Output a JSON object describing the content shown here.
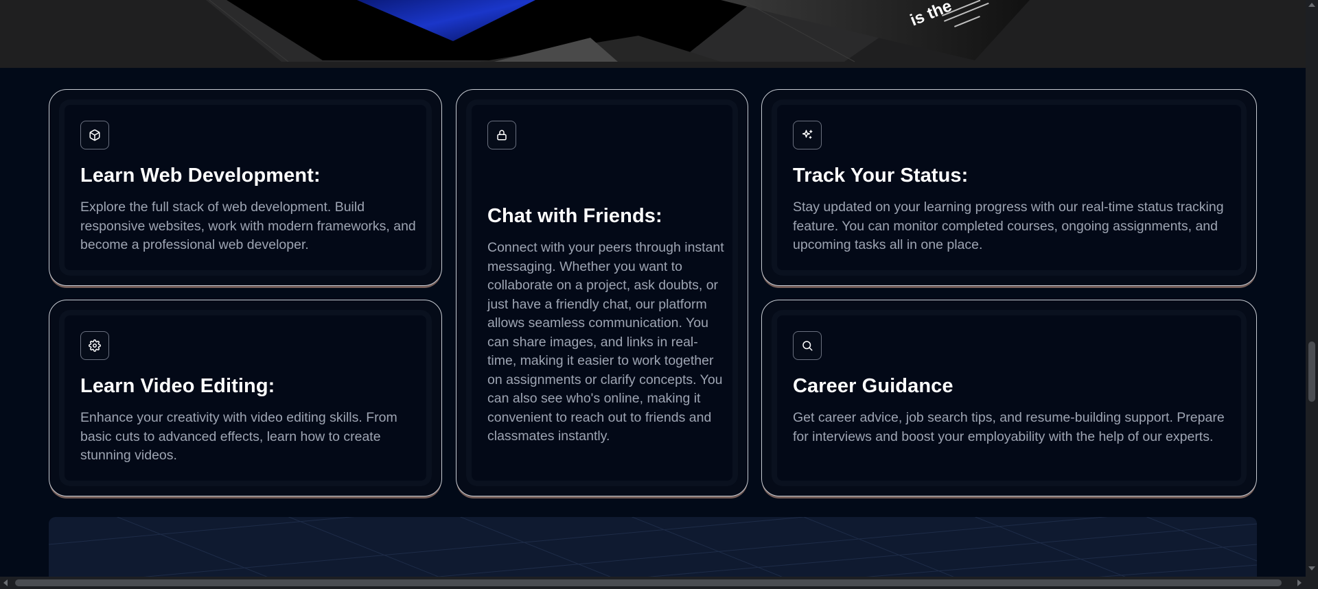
{
  "colors": {
    "page_bg": "#020a18",
    "card_border": "#c9cdd4",
    "card_glow": "#d2a08c",
    "heading": "#ffffff",
    "body_text": "#9ea5b3"
  },
  "features": [
    {
      "icon": "cube-icon",
      "title": "Learn Web Development:",
      "description": "Explore the full stack of web development. Build responsive websites, work with modern frameworks, and become a professional web developer."
    },
    {
      "icon": "lock-icon",
      "title": "Chat with Friends:",
      "description": "Connect with your peers through instant messaging. Whether you want to collaborate on a project, ask doubts, or just have a friendly chat, our platform allows seamless communication. You can share images, and links in real-time, making it easier to work together on assignments or clarify concepts. You can also see who's online, making it convenient to reach out to friends and classmates instantly."
    },
    {
      "icon": "sparkles-icon",
      "title": "Track Your Status:",
      "description": "Stay updated on your learning progress with our real-time status tracking feature. You can monitor completed courses, ongoing assignments, and upcoming tasks all in one place."
    },
    {
      "icon": "gear-icon",
      "title": "Learn Video Editing:",
      "description": "Enhance your creativity with video editing skills. From basic cuts to advanced effects, learn how to create stunning videos."
    },
    {
      "icon": "search-icon",
      "title": "Career Guidance",
      "description": "Get career advice, job search tips, and resume-building support. Prepare for interviews and boost your employability with the help of our experts."
    }
  ],
  "hero": {
    "partial_heading": "is the"
  }
}
